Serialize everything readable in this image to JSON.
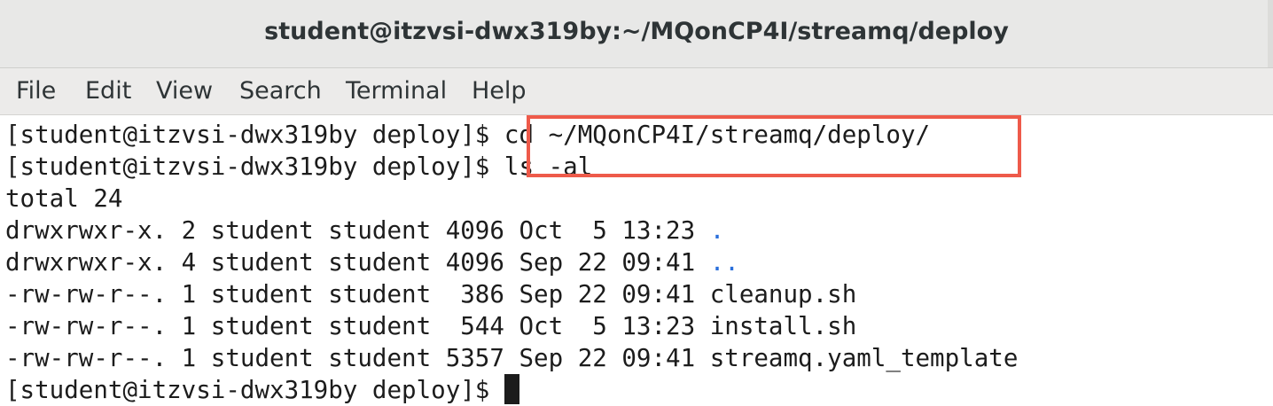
{
  "window": {
    "title": "student@itzvsi-dwx319by:~/MQonCP4I/streamq/deploy"
  },
  "menubar": {
    "items": [
      "File",
      "Edit",
      "View",
      "Search",
      "Terminal",
      "Help"
    ]
  },
  "terminal": {
    "lines": [
      {
        "prompt": "[student@itzvsi-dwx319by deploy]$",
        "cmd": " cd ~/MQonCP4I/streamq/deploy/"
      },
      {
        "prompt": "[student@itzvsi-dwx319by deploy]$",
        "cmd": " ls -al"
      },
      {
        "text": "total 24"
      },
      {
        "text": "drwxrwxr-x. 2 student student 4096 Oct  5 13:23 ",
        "name": "."
      },
      {
        "text": "drwxrwxr-x. 4 student student 4096 Sep 22 09:41 ",
        "name": ".."
      },
      {
        "text": "-rw-rw-r--. 1 student student  386 Sep 22 09:41 cleanup.sh"
      },
      {
        "text": "-rw-rw-r--. 1 student student  544 Oct  5 13:23 install.sh"
      },
      {
        "text": "-rw-rw-r--. 1 student student 5357 Sep 22 09:41 streamq.yaml_template"
      },
      {
        "prompt": "[student@itzvsi-dwx319by deploy]$",
        "cmd": " "
      }
    ]
  },
  "colors": {
    "highlight_border": "#ee5a4a",
    "dir_link": "#2a6fdb"
  }
}
